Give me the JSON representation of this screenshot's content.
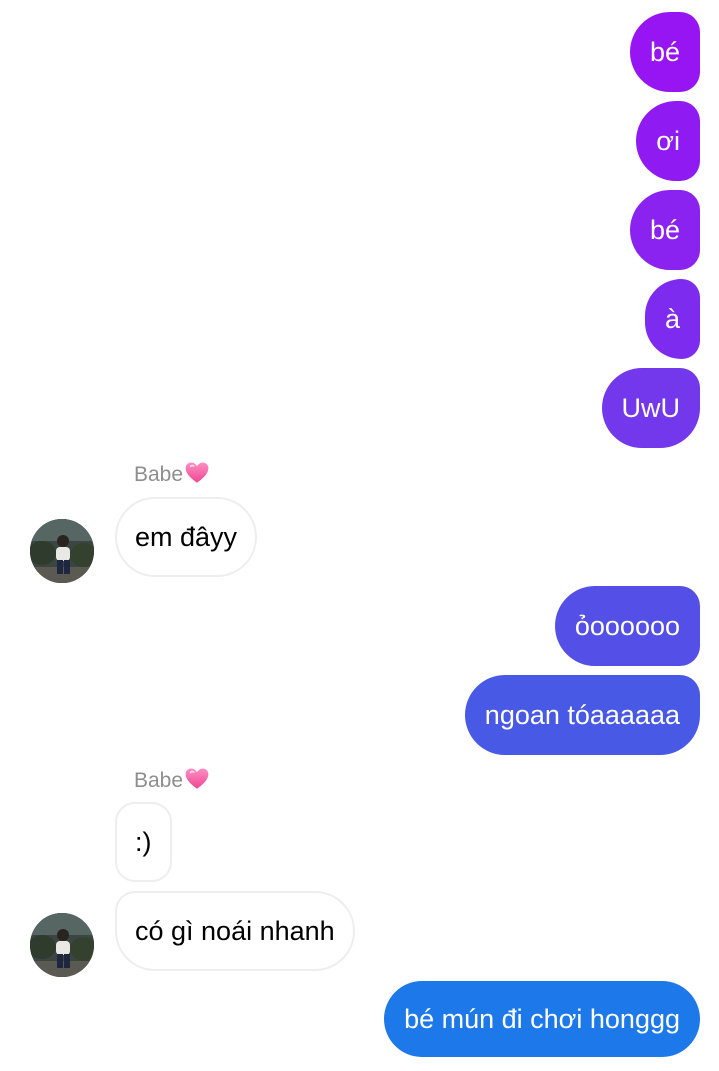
{
  "colors": {
    "outgoing_gradient_top": "#9b12f5",
    "outgoing_gradient_mid": "#5a4ae6",
    "outgoing_gradient_bottom": "#1f7ae8",
    "incoming_bubble_border": "#eeeeee",
    "sender_name": "#8e8e8e"
  },
  "messages": [
    {
      "direction": "out",
      "text": "bé"
    },
    {
      "direction": "out",
      "text": "ơi"
    },
    {
      "direction": "out",
      "text": "bé"
    },
    {
      "direction": "out",
      "text": "à"
    },
    {
      "direction": "out",
      "text": "UwU"
    },
    {
      "direction": "in",
      "sender": "Babe",
      "text": "em đâyy",
      "avatar_icon": "profile-photo"
    },
    {
      "direction": "out",
      "text": "ỏoooooo"
    },
    {
      "direction": "out",
      "text": "ngoan tóaaaaaa"
    },
    {
      "direction": "in",
      "sender": "Babe",
      "text": ":)"
    },
    {
      "direction": "in",
      "text": "có gì noái nhanh",
      "avatar_icon": "profile-photo"
    },
    {
      "direction": "out",
      "text": "bé mún đi chơi honggg"
    }
  ],
  "sender_badge_icon": "pink-heart-icon"
}
